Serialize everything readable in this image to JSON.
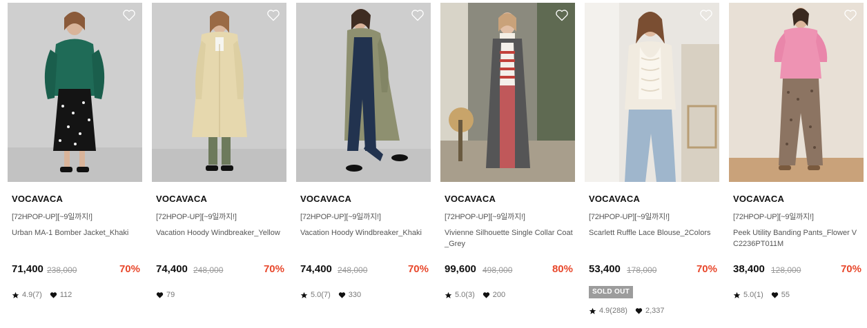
{
  "colors": {
    "discount": "#e8472b",
    "soldout_bg": "#9c9c9c",
    "text": "#111111",
    "muted": "#777777"
  },
  "products": [
    {
      "brand": "VOCAVACA",
      "promo": "[72HPOP-UP][~9일까지!]",
      "name": "Urban MA-1 Bomber Jacket_Khaki",
      "price": "71,400",
      "original_price": "238,000",
      "discount": "70%",
      "rating": "4.9(7)",
      "likes": "112",
      "sold_out": false
    },
    {
      "brand": "VOCAVACA",
      "promo": "[72HPOP-UP][~9일까지!]",
      "name": "Vacation Hoody Windbreaker_Yellow",
      "price": "74,400",
      "original_price": "248,000",
      "discount": "70%",
      "likes": "79",
      "sold_out": false
    },
    {
      "brand": "VOCAVACA",
      "promo": "[72HPOP-UP][~9일까지!]",
      "name": "Vacation Hoody Windbreaker_Khaki",
      "price": "74,400",
      "original_price": "248,000",
      "discount": "70%",
      "rating": "5.0(7)",
      "likes": "330",
      "sold_out": false
    },
    {
      "brand": "VOCAVACA",
      "promo": "[72HPOP-UP][~9일까지!]",
      "name": "Vivienne Silhouette Single Collar Coat_Grey",
      "price": "99,600",
      "original_price": "498,000",
      "discount": "80%",
      "rating": "5.0(3)",
      "likes": "200",
      "sold_out": false
    },
    {
      "brand": "VOCAVACA",
      "promo": "[72HPOP-UP][~9일까지!]",
      "name": "Scarlett Ruffle Lace Blouse_2Colors",
      "price": "53,400",
      "original_price": "178,000",
      "discount": "70%",
      "rating": "4.9(288)",
      "likes": "2,337",
      "sold_out": true,
      "sold_out_label": "SOLD OUT"
    },
    {
      "brand": "VOCAVACA",
      "promo": "[72HPOP-UP][~9일까지!]",
      "name": "Peek Utility Banding Pants_Flower VC2236PT011M",
      "price": "38,400",
      "original_price": "128,000",
      "discount": "70%",
      "rating": "5.0(1)",
      "likes": "55",
      "sold_out": false
    }
  ]
}
